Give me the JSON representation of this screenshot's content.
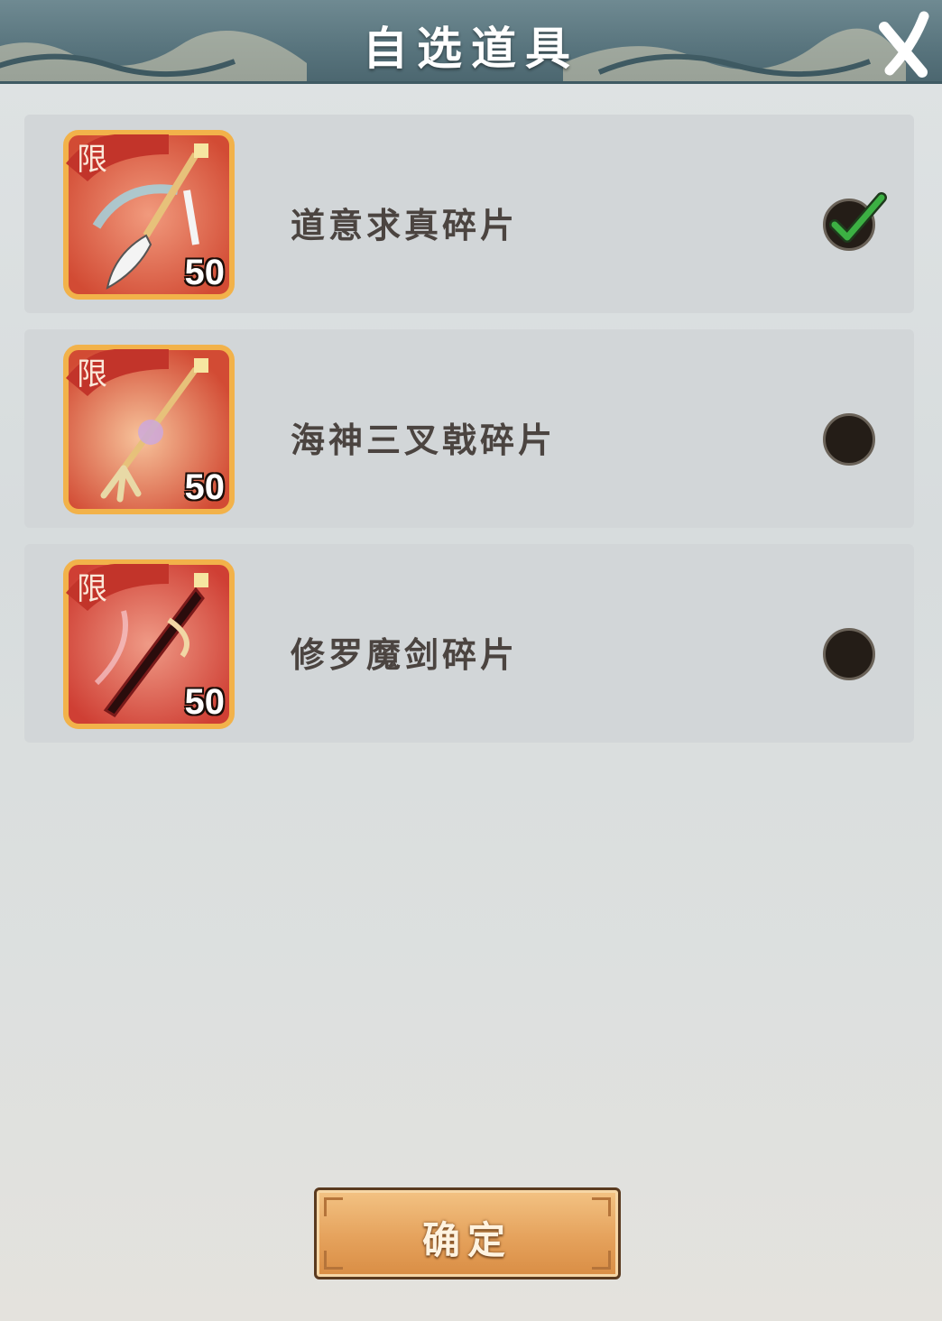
{
  "header": {
    "title": "自选道具"
  },
  "items": [
    {
      "name": "道意求真碎片",
      "quantity": "50",
      "limit_tag": "限",
      "selected": true,
      "icon": "whisk-weapon-icon"
    },
    {
      "name": "海神三叉戟碎片",
      "quantity": "50",
      "limit_tag": "限",
      "selected": false,
      "icon": "trident-weapon-icon"
    },
    {
      "name": "修罗魔剑碎片",
      "quantity": "50",
      "limit_tag": "限",
      "selected": false,
      "icon": "demon-sword-icon"
    }
  ],
  "footer": {
    "confirm_label": "确定"
  },
  "colors": {
    "header": "#58747d",
    "card": "#d2d6d8",
    "button": "#e5a25c",
    "check": "#3cb043"
  }
}
